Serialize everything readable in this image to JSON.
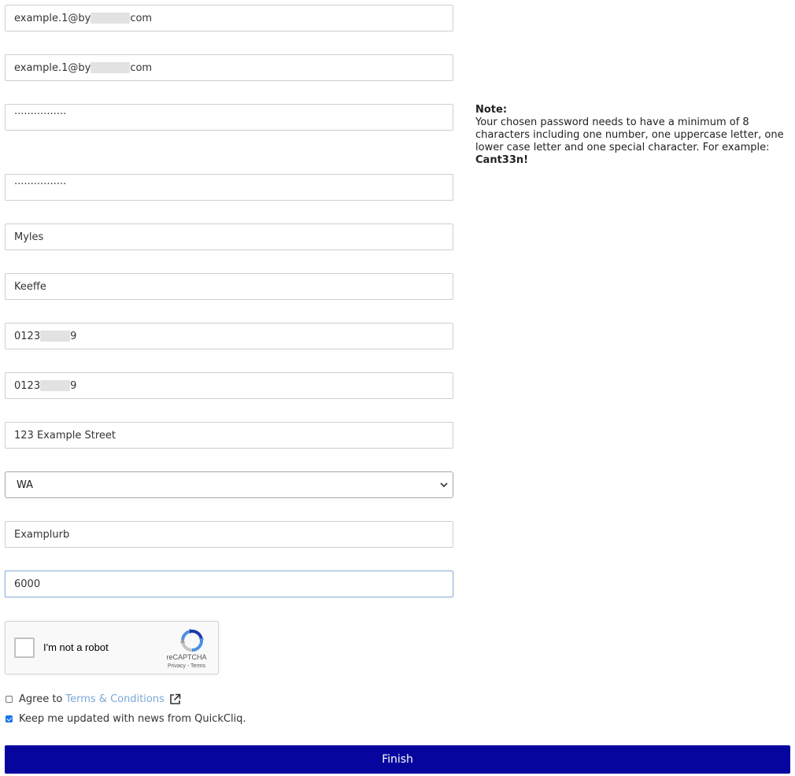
{
  "form": {
    "email": {
      "prefix": "example.1@by",
      "suffix": "com"
    },
    "email_confirm": {
      "prefix": "example.1@by",
      "suffix": "com"
    },
    "password": {
      "masked": "················"
    },
    "password_confirm": {
      "masked": "················"
    },
    "first_name": "Myles",
    "last_name": "Keeffe",
    "phone": {
      "prefix": "0123",
      "suffix": "9"
    },
    "mobile": {
      "prefix": "0123",
      "suffix": "9"
    },
    "street": "123 Example Street",
    "state": "WA",
    "suburb": "Examplurb",
    "postcode": "6000"
  },
  "note": {
    "title": "Note:",
    "text": "Your chosen password needs to have a minimum of 8 characters including one number, one uppercase letter, one lower case letter and one special character. For example: ",
    "example": "Cant33n!"
  },
  "recaptcha": {
    "label": "I'm not a robot",
    "brand": "reCAPTCHA",
    "links": "Privacy - Terms"
  },
  "terms": {
    "prefix": "Agree to",
    "link": "Terms & Conditions",
    "checked": false
  },
  "newsletter": {
    "label": "Keep me updated with news from QuickCliq.",
    "checked": true
  },
  "finish_label": "Finish",
  "icons": {
    "external": "external-link-icon",
    "recaptcha_logo": "recaptcha-logo-icon",
    "chevron": "chevron-down-icon"
  },
  "colors": {
    "finish_bg": "#06069e",
    "link": "#7aa7d8",
    "focus_border": "#8fb6da"
  }
}
